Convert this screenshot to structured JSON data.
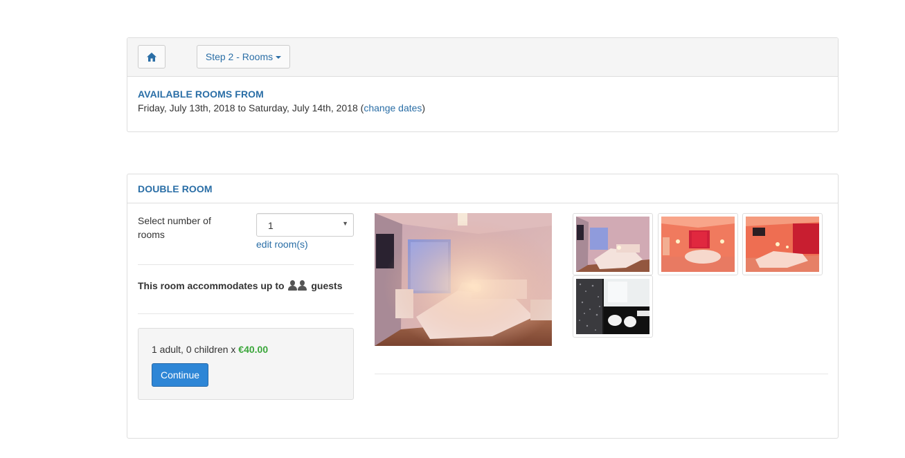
{
  "header": {
    "home_icon": "home-icon",
    "step_label": "Step 2 - Rooms"
  },
  "availability": {
    "title": "AVAILABLE ROOMS FROM",
    "dates": "Friday, July 13th, 2018 to Saturday, July 14th, 2018 (",
    "change_link": "change dates",
    "close_paren": ")"
  },
  "room": {
    "title": "DOUBLE ROOM",
    "select_label": "Select number of rooms",
    "select_value": "1",
    "edit_link": "edit room(s)",
    "accommodates_prefix": "This room accommodates up to",
    "accommodates_suffix": "guests",
    "guest_icon": "person-icon",
    "guest_count": 2,
    "price_prefix": "1 adult, 0 children x",
    "price_value": "€40.00",
    "continue_label": "Continue"
  },
  "colors": {
    "link": "#2a6ea6",
    "price": "#3aa63a",
    "primary_button": "#2e86d6"
  }
}
